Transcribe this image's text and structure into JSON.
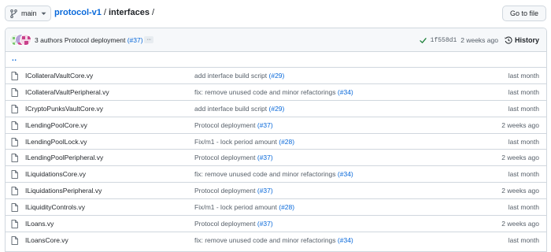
{
  "branch": {
    "label": "main"
  },
  "breadcrumb": {
    "repo": "protocol-v1",
    "sep1": "/",
    "dir": "interfaces",
    "sep2": "/"
  },
  "goto_file": {
    "label": "Go to file"
  },
  "latest_commit": {
    "authors": "3 authors",
    "message": "Protocol deployment",
    "pr": "(#37)",
    "more": "···",
    "sha": "1f558d1",
    "time": "2 weeks ago",
    "history_label": "History",
    "status_color": "#1a7f37"
  },
  "parent_link": "..",
  "files": [
    {
      "name": "ICollateralVaultCore.vy",
      "message": "add interface build script",
      "pr": "(#29)",
      "time": "last month"
    },
    {
      "name": "ICollateralVaultPeripheral.vy",
      "message": "fix: remove unused code and minor refactorings",
      "pr": "(#34)",
      "time": "last month"
    },
    {
      "name": "ICryptoPunksVaultCore.vy",
      "message": "add interface build script",
      "pr": "(#29)",
      "time": "last month"
    },
    {
      "name": "ILendingPoolCore.vy",
      "message": "Protocol deployment",
      "pr": "(#37)",
      "time": "2 weeks ago"
    },
    {
      "name": "ILendingPoolLock.vy",
      "message": "Fix/m1 - lock period amount",
      "pr": "(#28)",
      "time": "last month"
    },
    {
      "name": "ILendingPoolPeripheral.vy",
      "message": "Protocol deployment",
      "pr": "(#37)",
      "time": "2 weeks ago"
    },
    {
      "name": "ILiquidationsCore.vy",
      "message": "fix: remove unused code and minor refactorings",
      "pr": "(#34)",
      "time": "last month"
    },
    {
      "name": "ILiquidationsPeripheral.vy",
      "message": "Protocol deployment",
      "pr": "(#37)",
      "time": "2 weeks ago"
    },
    {
      "name": "ILiquidityControls.vy",
      "message": "Fix/m1 - lock period amount",
      "pr": "(#28)",
      "time": "last month"
    },
    {
      "name": "ILoans.vy",
      "message": "Protocol deployment",
      "pr": "(#37)",
      "time": "2 weeks ago"
    },
    {
      "name": "ILoansCore.vy",
      "message": "fix: remove unused code and minor refactorings",
      "pr": "(#34)",
      "time": "last month"
    }
  ],
  "icons": {
    "branch": "git-branch-icon",
    "caret": "caret-down-icon",
    "check": "check-icon",
    "history": "history-clock-icon",
    "file": "file-icon"
  },
  "colors": {
    "link": "#0969da",
    "muted": "#57606a",
    "border": "#d0d7de",
    "header_bg": "#f6f8fa"
  }
}
